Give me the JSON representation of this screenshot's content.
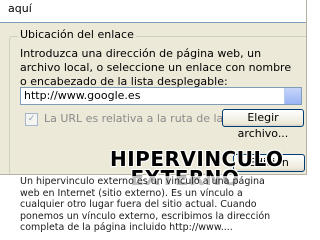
{
  "dialog": {
    "top_field_text": "aquí",
    "group_title": "Ubicación del enlace",
    "description": "Introduzca una dirección de página web, un archivo local, o seleccione un enlace con nombre o encabezado de la lista desplegable:",
    "url_value": "http://www.google.es",
    "relative_path_checkbox": {
      "label": "La URL es relativa a la ruta de la página",
      "checked": true
    },
    "choose_file_button": "Elegir archivo...",
    "advanced_edit_button": "Edición avanzada..."
  },
  "slide": {
    "heading_line1": "HIPERVINCULO",
    "heading_line2": "EXTERNO",
    "body": "Un hipervinculo externo es un vinculo a una página web en Internet (sitio externo). Es un vínculo a cualquier otro lugar fuera del sitio actual. Cuando ponemos un vínculo externo, escribimos la dirección completa de la página incluido http://www...."
  }
}
